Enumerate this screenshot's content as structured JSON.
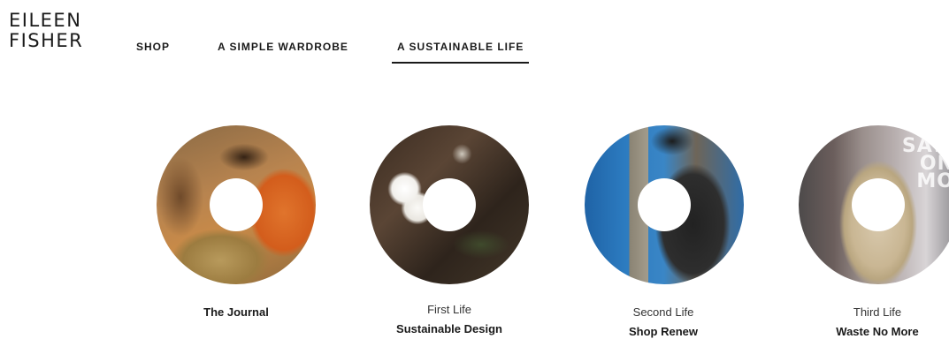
{
  "brand": {
    "logo_line1": "EILEEN",
    "logo_line2": "FISHER"
  },
  "nav": {
    "items": [
      {
        "label": "SHOP"
      },
      {
        "label": "A SIMPLE WARDROBE"
      },
      {
        "label": "A SUSTAINABLE LIFE",
        "active": true
      }
    ]
  },
  "features": [
    {
      "subtitle": "",
      "title": "The Journal"
    },
    {
      "subtitle": "First Life",
      "title": "Sustainable Design"
    },
    {
      "subtitle": "Second Life",
      "title": "Shop Renew"
    },
    {
      "subtitle": "Third Life",
      "title": "Waste No More",
      "image_text": [
        "SAW",
        "ON",
        "MO"
      ]
    }
  ],
  "colors": {
    "text": "#1a1a1a",
    "background": "#ffffff",
    "active_underline": "#1a1a1a"
  }
}
